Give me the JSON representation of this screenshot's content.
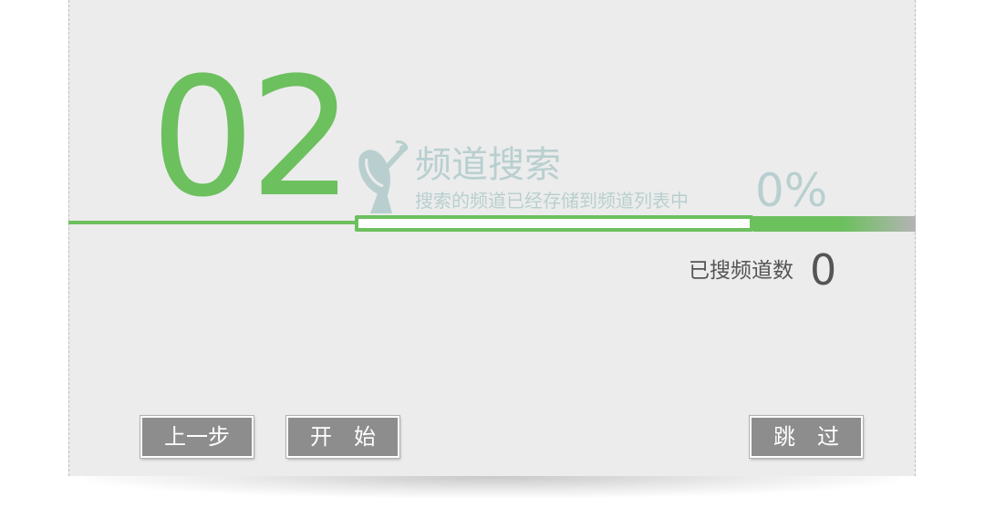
{
  "step": {
    "number": "02"
  },
  "section": {
    "title": "频道搜索",
    "subtitle": "搜索的频道已经存储到频道列表中",
    "icon": "satellite-dish-icon"
  },
  "progress": {
    "percent_text": "0%",
    "fraction": 0
  },
  "channel_count": {
    "label": "已搜频道数",
    "value": "0"
  },
  "buttons": {
    "prev_label": "上一步",
    "start_label": "开　始",
    "skip_label": "跳　过"
  },
  "colors": {
    "accent_green": "#6cc05e",
    "faded_teal": "#b9cfcf",
    "panel_bg": "#ececec",
    "button_bg": "#8d8d8d"
  }
}
